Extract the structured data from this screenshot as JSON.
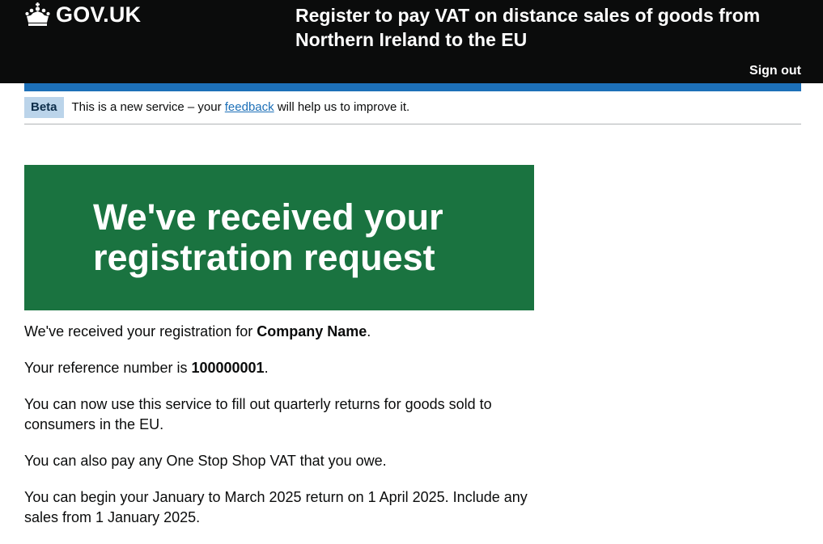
{
  "header": {
    "logo_text": "GOV.UK",
    "service_name": "Register to pay VAT on distance sales of goods from Northern Ireland to the EU",
    "sign_out": "Sign out"
  },
  "phase_banner": {
    "tag": "Beta",
    "text_before": "This is a new service – your ",
    "link": "feedback",
    "text_after": " will help us to improve it."
  },
  "panel": {
    "title": "We've received your registration request"
  },
  "content": {
    "p1_before": "We've received your registration for ",
    "company_name": "Company Name",
    "p1_after": ".",
    "p2_before": "Your reference number is ",
    "reference_number": "100000001",
    "p2_after": ".",
    "p3": "You can now use this service to fill out quarterly returns for goods sold to consumers in the EU.",
    "p4": "You can also pay any One Stop Shop VAT that you owe.",
    "p5": "You can begin your January to March 2025 return on 1 April 2025. Include any sales from 1 January 2025."
  },
  "colors": {
    "header_bg": "#0b0c0c",
    "header_accent": "#1d70b8",
    "panel_bg": "#1a7340",
    "link": "#1d70b8",
    "tag_bg": "#bbd4ea"
  }
}
